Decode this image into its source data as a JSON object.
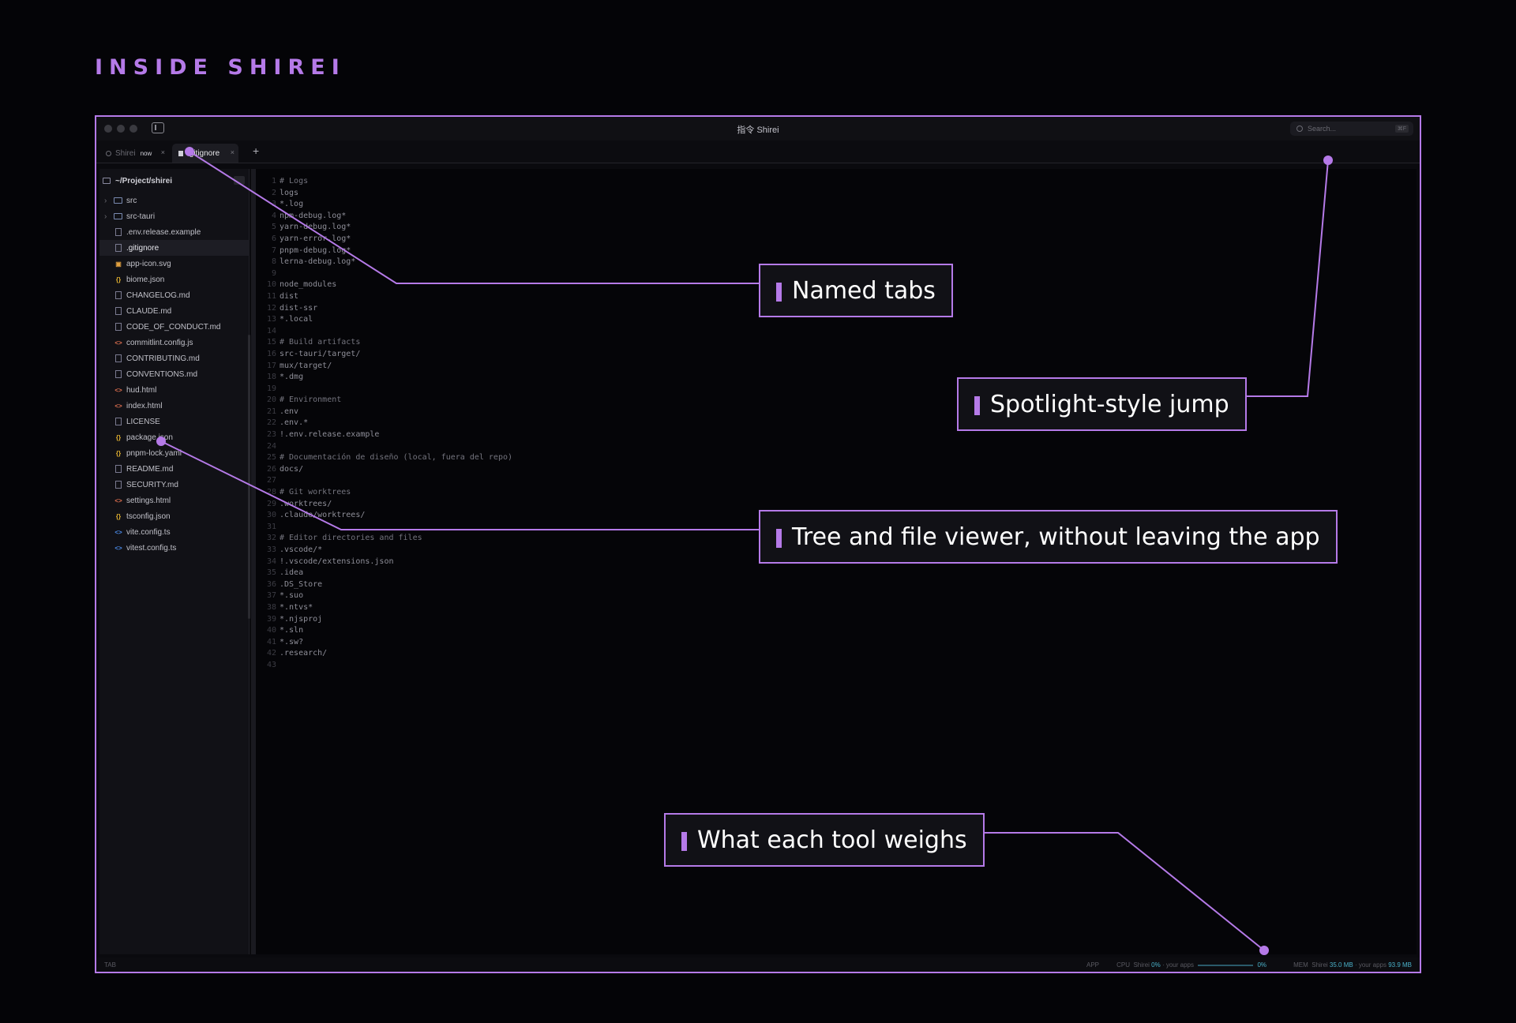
{
  "heading": "INSIDE SHIREI",
  "window": {
    "title": "指令 Shirei",
    "search_placeholder": "Search...",
    "search_shortcut": "⌘F"
  },
  "tabs": [
    {
      "label": "Shirei",
      "badge": "now",
      "close": "×"
    },
    {
      "label": ".gitignore",
      "close": "×"
    }
  ],
  "new_tab": "+",
  "sidebar": {
    "path": "~/Project/shirei",
    "items": [
      {
        "label": "src",
        "type": "folder"
      },
      {
        "label": "src-tauri",
        "type": "folder"
      },
      {
        "label": ".env.release.example",
        "type": "file"
      },
      {
        "label": ".gitignore",
        "type": "file",
        "selected": true
      },
      {
        "label": "app-icon.svg",
        "type": "image"
      },
      {
        "label": "biome.json",
        "type": "json"
      },
      {
        "label": "CHANGELOG.md",
        "type": "md"
      },
      {
        "label": "CLAUDE.md",
        "type": "md"
      },
      {
        "label": "CODE_OF_CONDUCT.md",
        "type": "md"
      },
      {
        "label": "commitlint.config.js",
        "type": "code"
      },
      {
        "label": "CONTRIBUTING.md",
        "type": "md"
      },
      {
        "label": "CONVENTIONS.md",
        "type": "md"
      },
      {
        "label": "hud.html",
        "type": "code"
      },
      {
        "label": "index.html",
        "type": "code"
      },
      {
        "label": "LICENSE",
        "type": "file"
      },
      {
        "label": "package.json",
        "type": "json"
      },
      {
        "label": "pnpm-lock.yaml",
        "type": "json"
      },
      {
        "label": "README.md",
        "type": "md"
      },
      {
        "label": "SECURITY.md",
        "type": "md"
      },
      {
        "label": "settings.html",
        "type": "code"
      },
      {
        "label": "tsconfig.json",
        "type": "json"
      },
      {
        "label": "vite.config.ts",
        "type": "ts"
      },
      {
        "label": "vitest.config.ts",
        "type": "ts"
      }
    ]
  },
  "editor": {
    "lines": [
      "# Logs",
      "logs",
      "*.log",
      "npm-debug.log*",
      "yarn-debug.log*",
      "yarn-error.log*",
      "pnpm-debug.log*",
      "lerna-debug.log*",
      "",
      "node_modules",
      "dist",
      "dist-ssr",
      "*.local",
      "",
      "# Build artifacts",
      "src-tauri/target/",
      "mux/target/",
      "*.dmg",
      "",
      "# Environment",
      ".env",
      ".env.*",
      "!.env.release.example",
      "",
      "# Documentación de diseño (local, fuera del repo)",
      "docs/",
      "",
      "# Git worktrees",
      ".worktrees/",
      ".claude/worktrees/",
      "",
      "# Editor directories and files",
      ".vscode/*",
      "!.vscode/extensions.json",
      ".idea",
      ".DS_Store",
      "*.suo",
      "*.ntvs*",
      "*.njsproj",
      "*.sln",
      "*.sw?",
      ".research/",
      ""
    ]
  },
  "statusbar": {
    "left": "TAB",
    "app": "APP",
    "cpu_label": "CPU",
    "cpu_shirei_label": "Shirei",
    "cpu_shirei": "0%",
    "cpu_apps_label": "your apps",
    "cpu_apps": "0%",
    "mem_label": "MEM",
    "mem_shirei_label": "Shirei",
    "mem_shirei": "35.0 MB",
    "mem_apps_label": "your apps",
    "mem_apps": "93.9 MB"
  },
  "annotations": {
    "named_tabs": "Named tabs",
    "spotlight": "Spotlight-style jump",
    "tree_viewer": "Tree and file viewer, without leaving the app",
    "tool_weight": "What each tool weighs"
  },
  "colors": {
    "accent": "#b57ae8",
    "background": "#040407",
    "stat_value": "#4ab0c8"
  }
}
